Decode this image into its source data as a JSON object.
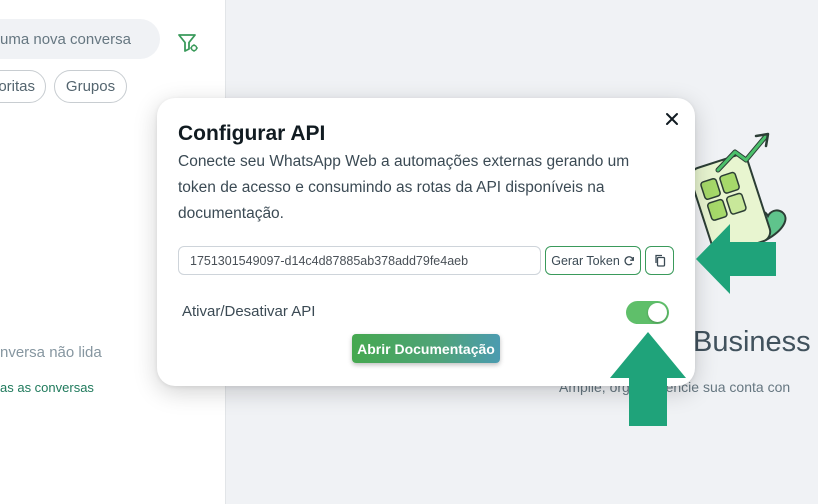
{
  "left_panel": {
    "search_placeholder": "uma nova conversa",
    "filters": [
      "oritas",
      "Grupos"
    ],
    "unread_text": "nversa não lida",
    "all_conversations_link": "as as conversas"
  },
  "intro": {
    "title": "Business W",
    "subtitle": "Amplie, org      e gerencie sua conta con"
  },
  "modal": {
    "title": "Configurar API",
    "description": "Conecte seu WhatsApp Web a automações externas gerando um token de acesso e consumindo as rotas da API disponíveis na documentação.",
    "token_value": "1751301549097-d14c4d87885ab378add79fe4aeb",
    "generate_token_label": "Gerar Token",
    "toggle_label": "Ativar/Desativar API",
    "toggle_on": true,
    "docs_button_label": "Abrir Documentação"
  },
  "colors": {
    "accent_green": "#3a9a5b",
    "toggle_on": "#5fbf6a",
    "annotation_arrow": "#1fa37a"
  },
  "icons": {
    "filter": "filter-icon",
    "close": "close-icon",
    "refresh": "refresh-icon",
    "copy": "copy-icon"
  }
}
